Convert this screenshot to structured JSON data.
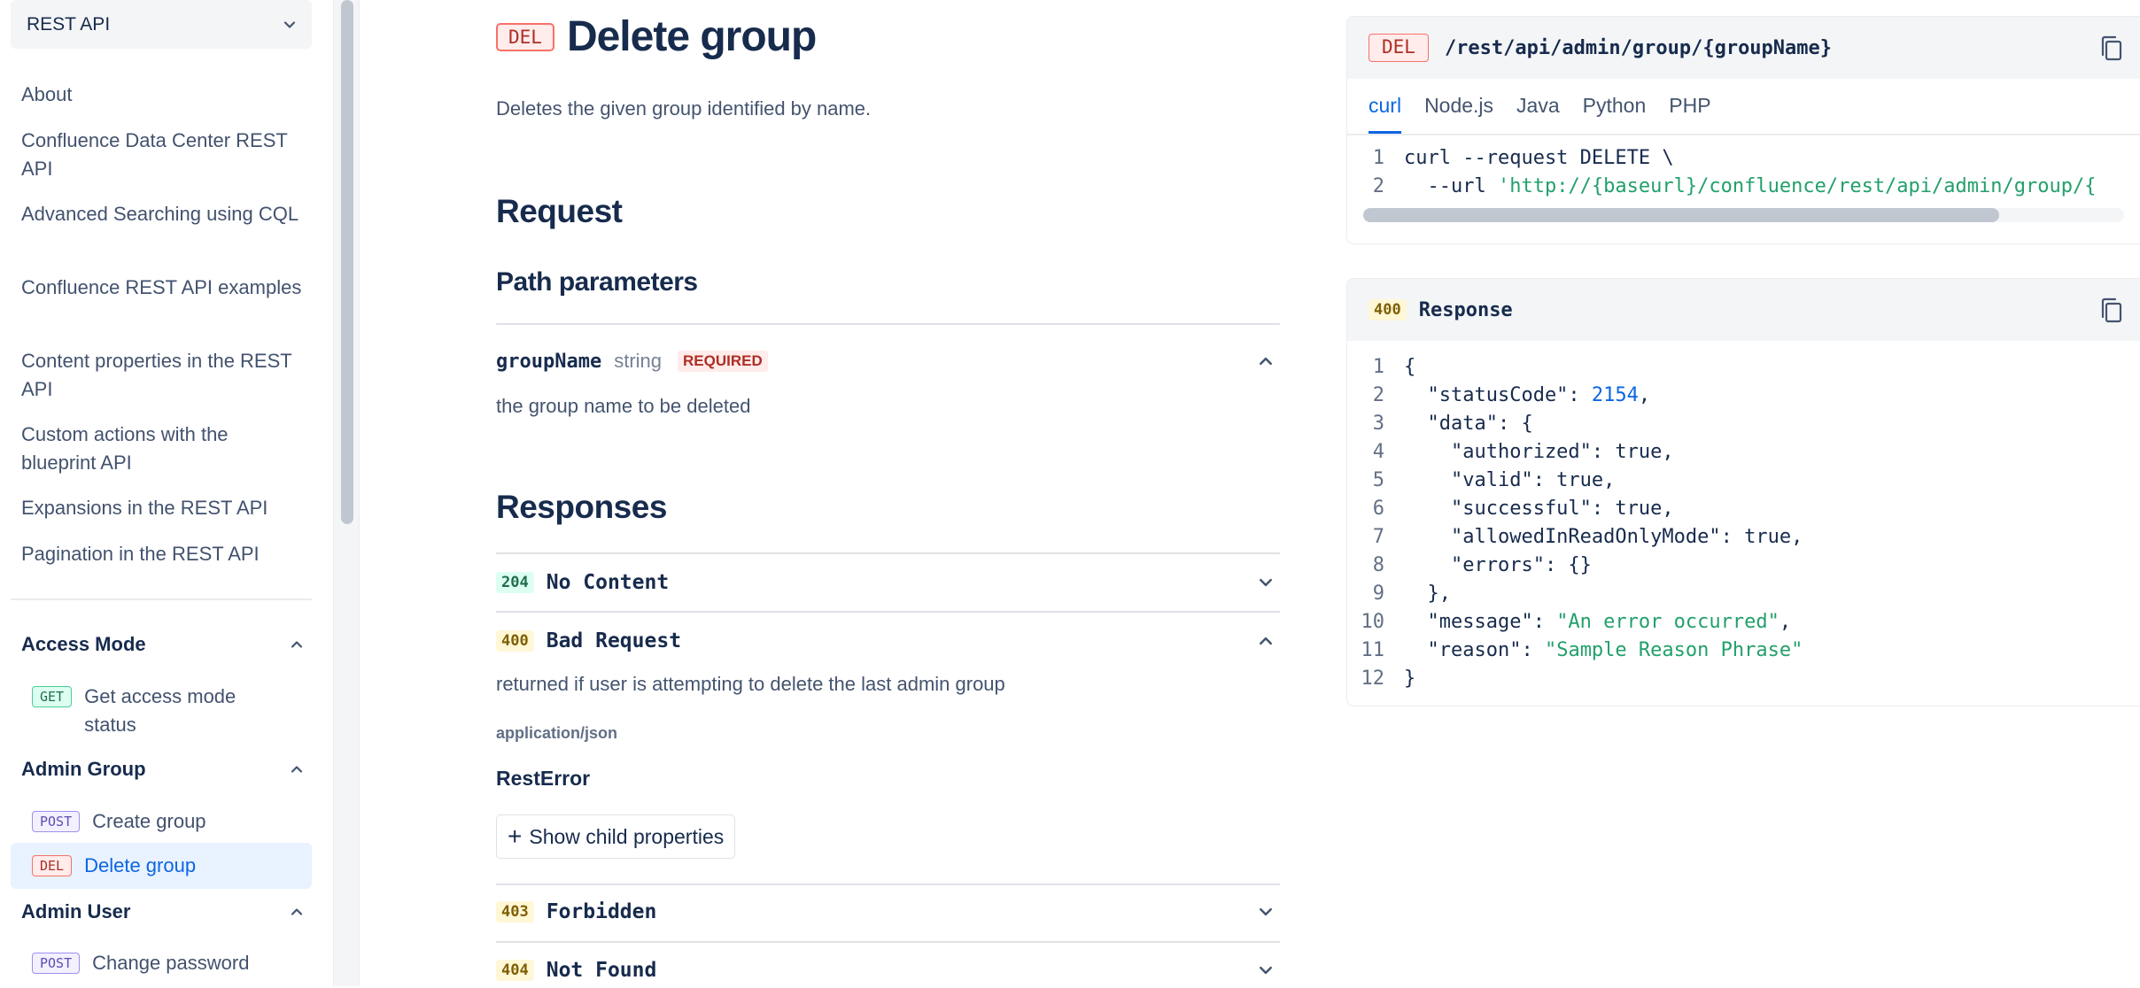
{
  "sidebar": {
    "api_selector": "REST API",
    "links": [
      "About",
      "Confluence Data Center REST API",
      "Advanced Searching using CQL",
      "Confluence REST API examples",
      "Content properties in the REST API",
      "Custom actions with the blueprint API",
      "Expansions in the REST API",
      "Pagination in the REST API"
    ],
    "sections": [
      {
        "title": "Access Mode",
        "items": [
          {
            "method": "GET",
            "label": "Get access mode status"
          }
        ]
      },
      {
        "title": "Admin Group",
        "items": [
          {
            "method": "POST",
            "label": "Create group"
          },
          {
            "method": "DEL",
            "label": "Delete group",
            "active": true
          }
        ]
      },
      {
        "title": "Admin User",
        "items": [
          {
            "method": "POST",
            "label": "Change password"
          }
        ]
      }
    ]
  },
  "main": {
    "method_badge": "DEL",
    "title": "Delete group",
    "description": "Deletes the given group identified by name.",
    "request_heading": "Request",
    "path_params_heading": "Path parameters",
    "param": {
      "name": "groupName",
      "type": "string",
      "required": "REQUIRED",
      "description": "the group name to be deleted"
    },
    "responses_heading": "Responses",
    "responses": [
      {
        "code": "204",
        "title": "No Content"
      },
      {
        "code": "400",
        "title": "Bad Request",
        "description": "returned if user is attempting to delete the last admin group",
        "media_type": "application/json",
        "schema": "RestError",
        "child_button": "Show child properties"
      },
      {
        "code": "403",
        "title": "Forbidden"
      },
      {
        "code": "404",
        "title": "Not Found"
      }
    ]
  },
  "request_panel": {
    "method": "DEL",
    "endpoint": "/rest/api/admin/group/{groupName}",
    "tabs": [
      "curl",
      "Node.js",
      "Java",
      "Python",
      "PHP"
    ],
    "active_tab": "curl",
    "code_lines": [
      "curl --request DELETE \\",
      "  --url 'http://{baseurl}/confluence/rest/api/admin/group/{"
    ]
  },
  "response_panel": {
    "code": "400",
    "title": "Response",
    "line_numbers": [
      "1",
      "2",
      "3",
      "4",
      "5",
      "6",
      "7",
      "8",
      "9",
      "10",
      "11",
      "12"
    ],
    "lines": [
      "{",
      "  \"statusCode\": ",
      "  \"data\": {",
      "    \"authorized\": true,",
      "    \"valid\": true,",
      "    \"successful\": true,",
      "    \"allowedInReadOnlyMode\": true,",
      "    \"errors\": {}",
      "  },",
      "  \"message\": ",
      "  \"reason\": ",
      "}"
    ],
    "status_value": "2154",
    "message_value": "\"An error occurred\"",
    "reason_value": "\"Sample Reason Phrase\"",
    "trailing_comma": ","
  },
  "colors": {
    "accent": "#0c66e4",
    "delete": "#ae2e24",
    "string": "#22a06b"
  }
}
